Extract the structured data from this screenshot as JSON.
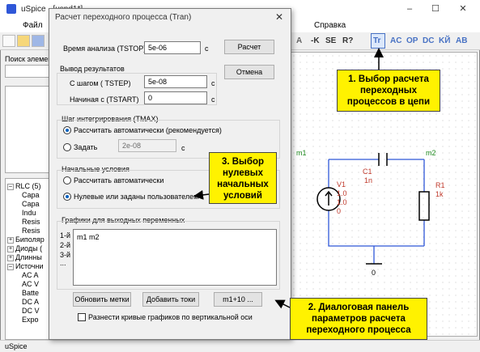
{
  "app": {
    "title": "uSpice - [uspd1*]",
    "min_icon": "–",
    "max_icon": "☐",
    "close_icon": "✕",
    "menu": [
      "Файл",
      "Справка"
    ],
    "toolbar_right": [
      "A",
      "-K",
      "SE",
      "R?",
      "Tr",
      "AC",
      "OP",
      "DC",
      "KЙ",
      "AB"
    ],
    "search_label": "Поиск элемент",
    "tree": [
      {
        "text": "RLC (5)",
        "level": 0,
        "expander": "–"
      },
      {
        "text": "Capa",
        "level": 1
      },
      {
        "text": "Capa",
        "level": 1
      },
      {
        "text": "Indu",
        "level": 1
      },
      {
        "text": "Resis",
        "level": 1
      },
      {
        "text": "Resis",
        "level": 1
      },
      {
        "text": "Биполяр",
        "level": 0,
        "expander": "+"
      },
      {
        "text": "Диоды (",
        "level": 0,
        "expander": "+"
      },
      {
        "text": "Длинны",
        "level": 0,
        "expander": "+"
      },
      {
        "text": "Источни",
        "level": 0,
        "expander": "–"
      },
      {
        "text": "AC A",
        "level": 1
      },
      {
        "text": "AC V",
        "level": 1
      },
      {
        "text": "Batte",
        "level": 1
      },
      {
        "text": "DC A",
        "level": 1
      },
      {
        "text": "DC V",
        "level": 1
      },
      {
        "text": "Expo",
        "level": 1
      }
    ],
    "status": "uSpice"
  },
  "dialog": {
    "title": "Расчет переходного процесса (Tran)",
    "close_icon": "✕",
    "tstop_label": "Время анализа (TSTOP)",
    "tstop_value": "5e-06",
    "tstop_unit": "с",
    "calc_button": "Расчет",
    "cancel_button": "Отмена",
    "output_group": "Вывод результатов",
    "tstep_label": "С шагом ( TSTEP)",
    "tstep_value": "5e-08",
    "tstep_unit": "с",
    "tstart_label": "Начиная с  (TSTART)",
    "tstart_value": "0",
    "tstart_unit": "с",
    "step_group": "Шаг интегрирования (TMAX)",
    "step_auto": "Рассчитать автоматически (рекомендуется)",
    "step_set": "Задать",
    "step_set_value": "2e-08",
    "step_unit": "с",
    "init_group": "Начальные условия",
    "init_auto": "Рассчитать автоматически",
    "init_user": "Нулевые или заданы пользователем",
    "graphs_group": "Графики для выходных переменных",
    "graph_rows": [
      "1-й",
      "2-й",
      "3-й",
      "..."
    ],
    "graph_text": "m1 m2",
    "btn_update": "Обновить метки",
    "btn_add": "Добавить токи",
    "btn_plus": "m1+10 ...",
    "split_check": "Разнести кривые графиков по вертикальной оси"
  },
  "schematic": {
    "node1": "m1",
    "node2": "m2",
    "ground": "0",
    "c1_name": "C1",
    "c1_value": "1n",
    "r1_name": "R1",
    "r1_value": "1k",
    "v1_name": "V1",
    "v1_p1": "1.0",
    "v1_p2": "1.0",
    "v1_p3": "0"
  },
  "callouts": {
    "c1": [
      "1. Выбор расчета",
      "переходных",
      "процессов в цепи"
    ],
    "c2": [
      "2. Диалоговая панель",
      "параметров расчета",
      "переходного процесса"
    ],
    "c3": [
      "3. Выбор",
      "нулевых",
      "начальных",
      "условий"
    ]
  },
  "colors": {
    "callout": "#fff200",
    "wire": "#2f57d8",
    "node": "#1f8a1f",
    "part": "#c0392b"
  }
}
